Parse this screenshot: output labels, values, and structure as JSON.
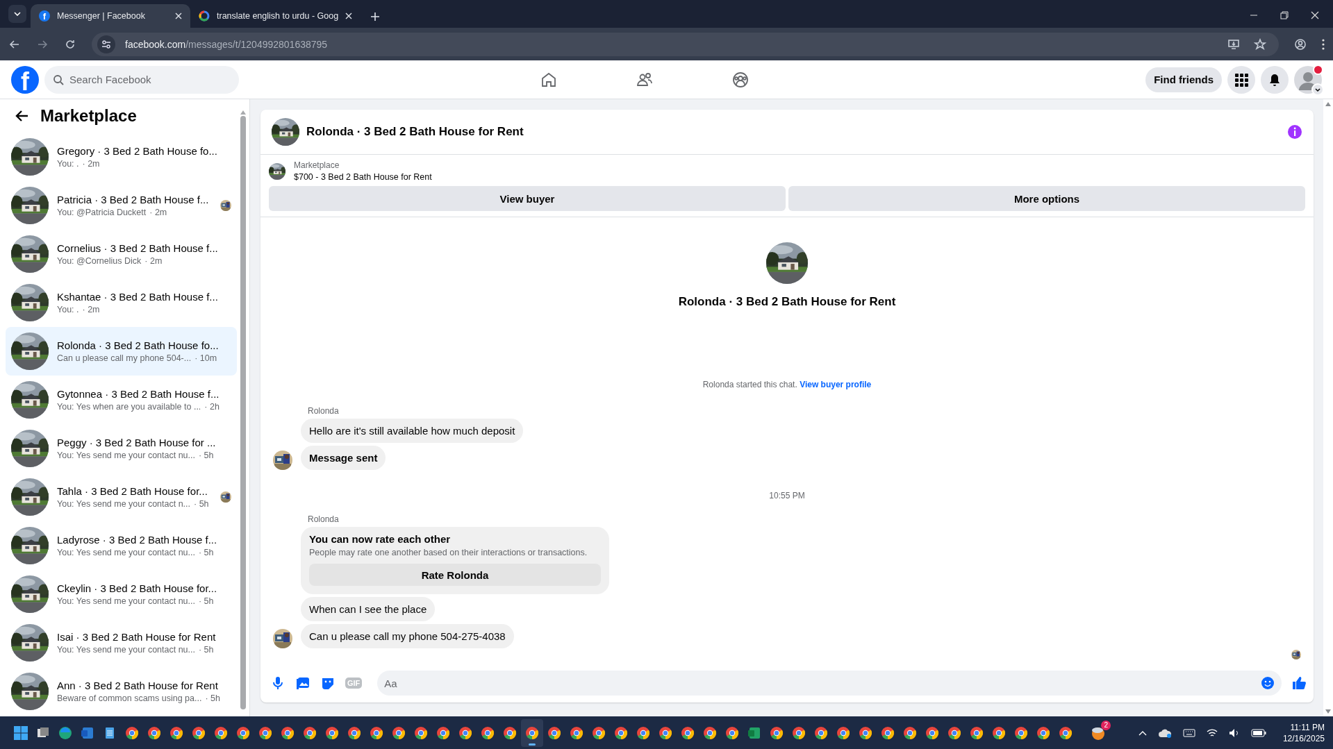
{
  "browser": {
    "tabs": [
      {
        "title": "Messenger | Facebook",
        "kind": "facebook",
        "icon_text": "f",
        "selected": true
      },
      {
        "title": "translate english to urdu - Goog",
        "kind": "google",
        "selected": false
      }
    ],
    "url_host": "facebook.com",
    "url_path": "/messages/t/1204992801638795"
  },
  "header": {
    "logo_text": "f",
    "search_placeholder": "Search Facebook",
    "find_friends": "Find friends",
    "profile_alert": true
  },
  "sidebar": {
    "title": "Marketplace",
    "conversations": [
      {
        "title": "Gregory · 3 Bed 2 Bath House fo...",
        "preview": "You: .",
        "time": "· 2m",
        "selected": false,
        "seen_avatar": false
      },
      {
        "title": "Patricia · 3 Bed 2 Bath House f...",
        "preview": "You: @Patricia Duckett",
        "time": "· 2m",
        "selected": false,
        "seen_avatar": true
      },
      {
        "title": "Cornelius · 3 Bed 2 Bath House f...",
        "preview": "You: @Cornelius Dick",
        "time": "· 2m",
        "selected": false,
        "seen_avatar": false
      },
      {
        "title": "Kshantae · 3 Bed 2 Bath House f...",
        "preview": "You: .",
        "time": "· 2m",
        "selected": false,
        "seen_avatar": false
      },
      {
        "title": "Rolonda · 3 Bed 2 Bath House fo...",
        "preview": "Can u please call my phone 504-...",
        "time": "· 10m",
        "selected": true,
        "seen_avatar": false
      },
      {
        "title": "Gytonnea · 3 Bed 2 Bath House f...",
        "preview": "You: Yes when are you available to ...",
        "time": "· 2h",
        "selected": false,
        "seen_avatar": false
      },
      {
        "title": "Peggy · 3 Bed 2 Bath House for ...",
        "preview": "You: Yes send me your contact nu...",
        "time": "· 5h",
        "selected": false,
        "seen_avatar": false
      },
      {
        "title": "Tahla · 3 Bed 2 Bath House for...",
        "preview": "You: Yes send me your contact n...",
        "time": "· 5h",
        "selected": false,
        "seen_avatar": true
      },
      {
        "title": "Ladyrose · 3 Bed 2 Bath House f...",
        "preview": "You: Yes send me your contact nu...",
        "time": "· 5h",
        "selected": false,
        "seen_avatar": false
      },
      {
        "title": "Ckeylin · 3 Bed 2 Bath House for...",
        "preview": "You: Yes send me your contact nu...",
        "time": "· 5h",
        "selected": false,
        "seen_avatar": false
      },
      {
        "title": "Isai · 3 Bed 2 Bath House for Rent",
        "preview": "You: Yes send me your contact nu...",
        "time": "· 5h",
        "selected": false,
        "seen_avatar": false
      },
      {
        "title": "Ann · 3 Bed 2 Bath House for Rent",
        "preview": "Beware of common scams using pa...",
        "time": "· 5h",
        "selected": false,
        "seen_avatar": false
      }
    ]
  },
  "chat": {
    "title": "Rolonda · 3 Bed 2 Bath House for Rent",
    "listing": {
      "source": "Marketplace",
      "summary": "$700 - 3 Bed 2 Bath House for Rent"
    },
    "buttons": [
      "View buyer",
      "More options"
    ],
    "intro_title": "Rolonda · 3 Bed 2 Bath House for Rent",
    "started": {
      "text": "Rolonda started this chat.",
      "link": "View buyer profile"
    },
    "messages": [
      {
        "kind": "sender",
        "text": "Rolonda"
      },
      {
        "kind": "bubble",
        "text": "Hello are it's still available how much deposit",
        "avatar": false,
        "bold": false
      },
      {
        "kind": "bubble",
        "text": "Message sent",
        "avatar": true,
        "bold": true
      },
      {
        "kind": "time",
        "text": "10:55 PM"
      },
      {
        "kind": "sender",
        "text": "Rolonda"
      },
      {
        "kind": "rating",
        "title": "You can now rate each other",
        "text": "People may rate one another based on their interactions or transactions.",
        "button": "Rate Rolonda"
      },
      {
        "kind": "bubble",
        "text": "When can I see the place",
        "avatar": false,
        "bold": false
      },
      {
        "kind": "bubble",
        "text": "Can u please call my phone 504-275-4038",
        "avatar": true,
        "bold": false
      }
    ],
    "seen": true,
    "composer": {
      "gif_label": "GIF",
      "placeholder": "Aa"
    }
  },
  "taskbar": {
    "apps": [
      {
        "kind": "start",
        "selected": false
      },
      {
        "kind": "taskview",
        "selected": false
      },
      {
        "kind": "edge",
        "selected": false
      },
      {
        "kind": "word",
        "selected": false
      },
      {
        "kind": "notepad",
        "selected": false
      },
      {
        "kind": "chrome",
        "selected": false
      },
      {
        "kind": "chrome",
        "selected": false
      },
      {
        "kind": "chrome",
        "selected": false
      },
      {
        "kind": "chrome",
        "selected": false
      },
      {
        "kind": "chrome",
        "selected": false
      },
      {
        "kind": "chrome",
        "selected": false
      },
      {
        "kind": "chrome",
        "selected": false
      },
      {
        "kind": "chrome",
        "selected": false
      },
      {
        "kind": "chrome",
        "selected": false
      },
      {
        "kind": "chrome",
        "selected": false
      },
      {
        "kind": "chrome",
        "selected": false
      },
      {
        "kind": "chrome",
        "selected": false
      },
      {
        "kind": "chrome",
        "selected": false
      },
      {
        "kind": "chrome",
        "selected": false
      },
      {
        "kind": "chrome",
        "selected": false
      },
      {
        "kind": "chrome",
        "selected": false
      },
      {
        "kind": "chrome",
        "selected": false
      },
      {
        "kind": "chrome",
        "selected": false
      },
      {
        "kind": "chrome",
        "selected": true
      },
      {
        "kind": "chrome",
        "selected": false
      },
      {
        "kind": "chrome",
        "selected": false
      },
      {
        "kind": "chrome",
        "selected": false
      },
      {
        "kind": "chrome",
        "selected": false
      },
      {
        "kind": "chrome",
        "selected": false
      },
      {
        "kind": "chrome",
        "selected": false
      },
      {
        "kind": "chrome",
        "selected": false
      },
      {
        "kind": "chrome",
        "selected": false
      },
      {
        "kind": "chrome",
        "selected": false
      },
      {
        "kind": "excel",
        "selected": false
      },
      {
        "kind": "chrome",
        "selected": false
      },
      {
        "kind": "chrome",
        "selected": false
      },
      {
        "kind": "chrome",
        "selected": false
      },
      {
        "kind": "chrome",
        "selected": false
      },
      {
        "kind": "chrome",
        "selected": false
      },
      {
        "kind": "chrome",
        "selected": false
      },
      {
        "kind": "chrome",
        "selected": false
      },
      {
        "kind": "chrome",
        "selected": false
      },
      {
        "kind": "chrome",
        "selected": false
      },
      {
        "kind": "chrome",
        "selected": false
      },
      {
        "kind": "chrome",
        "selected": false
      },
      {
        "kind": "chrome",
        "selected": false
      },
      {
        "kind": "chrome",
        "selected": false
      },
      {
        "kind": "chrome",
        "selected": false
      }
    ],
    "widget_badge": "2",
    "time": "11:11 PM",
    "date": "12/16/2025"
  }
}
